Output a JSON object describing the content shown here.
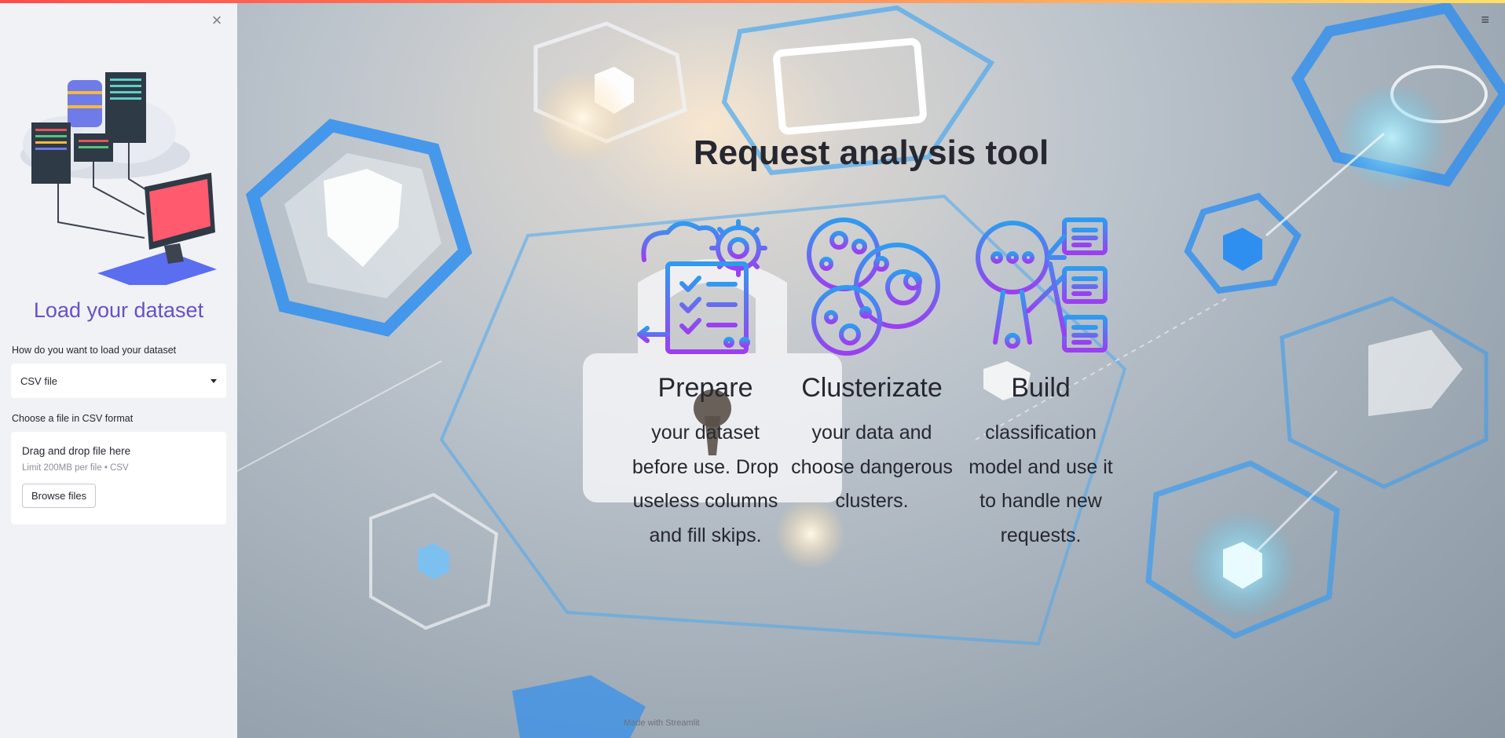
{
  "sidebar": {
    "close_icon": "close-icon",
    "title": "Load your dataset",
    "load_method_label": "How do you want to load your dataset",
    "load_method_value": "CSV file",
    "file_label": "Choose a file in CSV format",
    "uploader": {
      "drop_text": "Drag and drop file here",
      "limit_text": "Limit 200MB per file • CSV",
      "browse_label": "Browse files"
    }
  },
  "main": {
    "menu_icon": "hamburger-menu-icon",
    "title": "Request analysis tool",
    "features": [
      {
        "icon": "prepare-checklist-icon",
        "title": "Prepare",
        "description": "your dataset before use. Drop useless columns and fill skips."
      },
      {
        "icon": "cluster-icon",
        "title": "Clusterizate",
        "description": "your data and choose dangerous clusters."
      },
      {
        "icon": "build-magnifier-icon",
        "title": "Build",
        "description": "classification model and use it to handle new requests."
      }
    ],
    "footer": "Made with Streamlit"
  },
  "colors": {
    "accent": "#6a4fc6",
    "icon_gradient_start": "#2f9bf0",
    "icon_gradient_end": "#9b3ff0",
    "sidebar_bg": "#f0f2f6",
    "top_bar": "#ff4b4b"
  }
}
